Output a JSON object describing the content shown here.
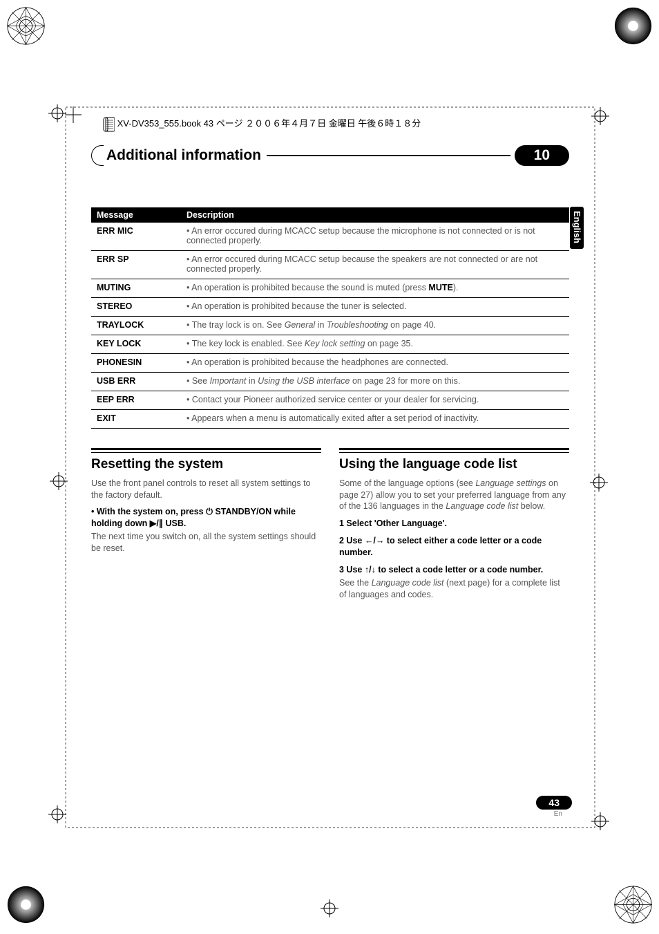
{
  "print_header": "XV-DV353_555.book 43 ページ ２００６年４月７日 金曜日 午後６時１８分",
  "title_bar": {
    "title": "Additional information",
    "chapter": "10"
  },
  "side_tab": "English",
  "table": {
    "headers": [
      "Message",
      "Description"
    ],
    "rows": [
      {
        "msg": "ERR MIC",
        "desc_pre": "• An error occured during MCACC setup because the microphone is not connected or is not connected properly."
      },
      {
        "msg": "ERR SP",
        "desc_pre": "• An error occured during MCACC setup because the speakers are not connected or are not connected properly."
      },
      {
        "msg": "MUTING",
        "desc_pre": "• An operation is prohibited because the sound is muted (press ",
        "bold": "MUTE",
        "desc_post": ")."
      },
      {
        "msg": "STEREO",
        "desc_pre": "• An operation is prohibited because the tuner is selected."
      },
      {
        "msg": "TRAYLOCK",
        "desc_pre": "• The tray lock is on. See ",
        "italic1": "General",
        "mid": " in ",
        "italic2": "Troubleshooting",
        "desc_post": " on page 40."
      },
      {
        "msg": "KEY LOCK",
        "desc_pre": "• The key lock is enabled. See ",
        "italic1": "Key lock setting",
        "desc_post": " on page 35."
      },
      {
        "msg": "PHONESIN",
        "desc_pre": "• An operation is prohibited because the headphones are connected."
      },
      {
        "msg": "USB ERR",
        "desc_pre": "• See ",
        "italic1": "Important",
        "mid": " in ",
        "italic2": "Using the USB interface",
        "desc_post": " on page 23 for more on this."
      },
      {
        "msg": "EEP ERR",
        "desc_pre": "• Contact your Pioneer authorized service center or your dealer for servicing."
      },
      {
        "msg": "EXIT",
        "desc_pre": "• Appears when a menu is automatically exited after a set period of inactivity."
      }
    ]
  },
  "left_col": {
    "heading": "Resetting the system",
    "p1": "Use the front panel controls to reset all system settings to the factory default.",
    "step_pre": "•    With the system on, press ",
    "step_glyph1": "⏻",
    "step_mid1": " STANDBY/ON while holding down ",
    "step_glyph2": "▶/∥",
    "step_mid2": " USB.",
    "p2": "The next time you switch on, all the system settings should be reset."
  },
  "right_col": {
    "heading": "Using the language code list",
    "p1_pre": "Some of the language options (see ",
    "p1_italic": "Language settings",
    "p1_mid": " on page 27) allow you to set your preferred language from any of the 136 languages in the ",
    "p1_italic2": "Language code list",
    "p1_post": " below.",
    "step1": "1    Select 'Other Language'.",
    "step2_pre": "2    Use ",
    "step2_glyph": "←/→",
    "step2_post": " to select either a code letter or a code number.",
    "step3_pre": "3    Use ",
    "step3_glyph": "↑/↓",
    "step3_post": " to select a code letter or a code number.",
    "p2_pre": "See the ",
    "p2_italic": "Language code list",
    "p2_post": " (next page) for a complete list of languages and codes."
  },
  "footer": {
    "page": "43",
    "lang": "En"
  }
}
